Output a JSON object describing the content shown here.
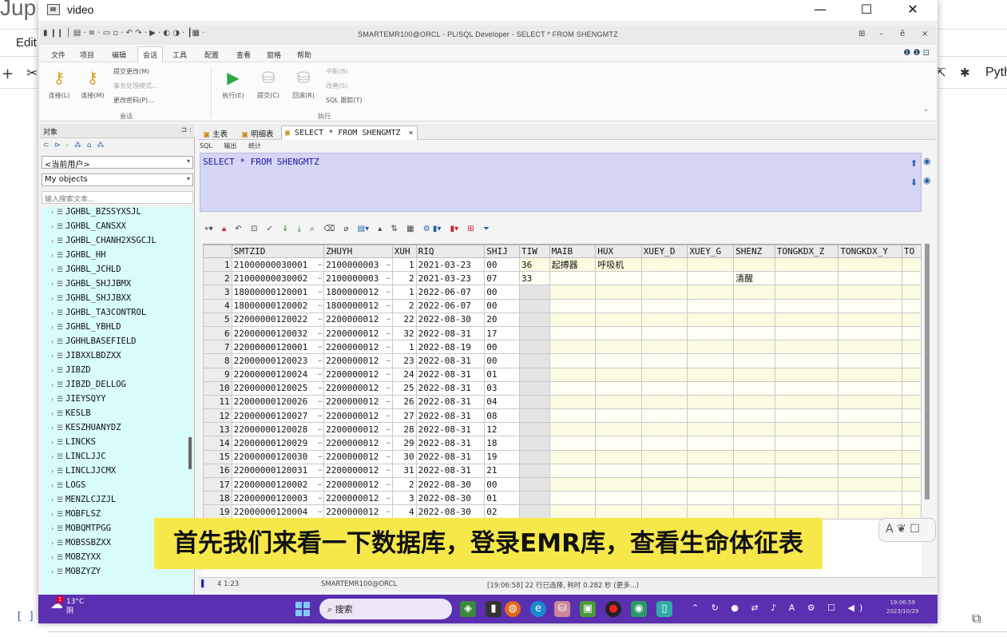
{
  "background": {
    "logo": "Jup",
    "menu_edit": "Edit",
    "plus": "+",
    "right_label": "Pyth",
    "bracket": "[ ]"
  },
  "video_window": {
    "title": "video",
    "minimize": "—",
    "maximize": "☐",
    "close": "✕"
  },
  "app": {
    "title": "SMARTEMR100@ORCL - PL/SQL Developer - SELECT * FROM SHENGMTZ",
    "menus": [
      "文件",
      "项目",
      "编辑",
      "会话",
      "工具",
      "配置",
      "查看",
      "窗格",
      "帮助"
    ],
    "active_menu_index": 3,
    "ribbon": {
      "connect": "连接(L)",
      "logon": "连接(M)",
      "session_items": [
        "提交更改(M)",
        "事务处理模式...",
        "更改密码(P)..."
      ],
      "group_session": "会话",
      "execute": "执行(E)",
      "breakpoint": "提交(C)",
      "rollback": "回滚(R)",
      "exec_items": [
        "中断(B)",
        "改善(S)",
        "SQL 跟踪(T)"
      ],
      "group_exec": "执行"
    },
    "object_panel": {
      "title": "对象",
      "tools": "⊂ ⊳ - ⁂ ⌂ ⁂",
      "combo_user": "<当前用户>",
      "combo_objects": "My objects",
      "filter_placeholder": "输入搜索文本...",
      "items": [
        "JGHBL_BZSSYXSJL",
        "JGHBL_CANSXX",
        "JGHBL_CHANH2XSGCJL",
        "JGHBL_HH",
        "JGHBL_JCHLD",
        "JGHBL_SHJJBMX",
        "JGHBL_SHJJBXX",
        "JGHBL_TA3CONTROL",
        "JGHBL_YBHLD",
        "JGHHLBASEFIELD",
        "JIBXXLBDZXX",
        "JIBZD",
        "JIBZD_DELLOG",
        "JIEYSQYY",
        "KESLB",
        "KESZHUANYDZ",
        "LINCKS",
        "LINCLJJC",
        "LINCLJJCMX",
        "LOGS",
        "MENZLCJZJL",
        "MOBFLSZ",
        "MOBQMTPGG",
        "MOBSSBZXX",
        "MOBZYXX",
        "MOBZYZY"
      ]
    },
    "tabs": [
      {
        "label": "主表"
      },
      {
        "label": "明细表"
      },
      {
        "label": "SELECT * FROM SHENGMTZ"
      }
    ],
    "subtabs": [
      "SQL",
      "输出",
      "统计"
    ],
    "sql_text": "SELECT * FROM SHENGMTZ",
    "grid": {
      "columns": [
        "SMTZID",
        "ZHUYH",
        "XUH",
        "RIQ",
        "SHIJ",
        "TIW",
        "MAIB",
        "HUX",
        "XUEY_D",
        "XUEY_G",
        "SHENZ",
        "TONGKDX_Z",
        "TONGKDX_Y",
        "TO"
      ],
      "rows": [
        [
          "1",
          "21000000030001",
          "2100000003",
          "1",
          "2021-03-23",
          "00",
          "36",
          "起搏器",
          "呼吸机",
          "",
          "",
          "",
          "",
          "",
          ""
        ],
        [
          "2",
          "21000000030002",
          "2100000003",
          "2",
          "2021-03-23",
          "07",
          "33",
          "",
          "",
          "",
          "",
          "清醒",
          "",
          "",
          ""
        ],
        [
          "3",
          "18000000120001",
          "1800000012",
          "1",
          "2022-06-07",
          "00",
          "",
          "",
          "",
          "",
          "",
          "",
          "",
          "",
          ""
        ],
        [
          "4",
          "18000000120002",
          "1800000012",
          "2",
          "2022-06-07",
          "00",
          "",
          "",
          "",
          "",
          "",
          "",
          "",
          "",
          ""
        ],
        [
          "5",
          "22000000120022",
          "2200000012",
          "22",
          "2022-08-30",
          "20",
          "",
          "",
          "",
          "",
          "",
          "",
          "",
          "",
          ""
        ],
        [
          "6",
          "22000000120032",
          "2200000012",
          "32",
          "2022-08-31",
          "17",
          "",
          "",
          "",
          "",
          "",
          "",
          "",
          "",
          ""
        ],
        [
          "7",
          "22000000120001",
          "2200000012",
          "1",
          "2022-08-19",
          "00",
          "",
          "",
          "",
          "",
          "",
          "",
          "",
          "",
          ""
        ],
        [
          "8",
          "22000000120023",
          "2200000012",
          "23",
          "2022-08-31",
          "00",
          "",
          "",
          "",
          "",
          "",
          "",
          "",
          "",
          ""
        ],
        [
          "9",
          "22000000120024",
          "2200000012",
          "24",
          "2022-08-31",
          "01",
          "",
          "",
          "",
          "",
          "",
          "",
          "",
          "",
          ""
        ],
        [
          "10",
          "22000000120025",
          "2200000012",
          "25",
          "2022-08-31",
          "03",
          "",
          "",
          "",
          "",
          "",
          "",
          "",
          "",
          ""
        ],
        [
          "11",
          "22000000120026",
          "2200000012",
          "26",
          "2022-08-31",
          "04",
          "",
          "",
          "",
          "",
          "",
          "",
          "",
          "",
          ""
        ],
        [
          "12",
          "22000000120027",
          "2200000012",
          "27",
          "2022-08-31",
          "08",
          "",
          "",
          "",
          "",
          "",
          "",
          "",
          "",
          ""
        ],
        [
          "13",
          "22000000120028",
          "2200000012",
          "28",
          "2022-08-31",
          "12",
          "",
          "",
          "",
          "",
          "",
          "",
          "",
          "",
          ""
        ],
        [
          "14",
          "22000000120029",
          "2200000012",
          "29",
          "2022-08-31",
          "18",
          "",
          "",
          "",
          "",
          "",
          "",
          "",
          "",
          ""
        ],
        [
          "15",
          "22000000120030",
          "2200000012",
          "30",
          "2022-08-31",
          "19",
          "",
          "",
          "",
          "",
          "",
          "",
          "",
          "",
          ""
        ],
        [
          "16",
          "22000000120031",
          "2200000012",
          "31",
          "2022-08-31",
          "21",
          "",
          "",
          "",
          "",
          "",
          "",
          "",
          "",
          ""
        ],
        [
          "17",
          "22000000120002",
          "2200000012",
          "2",
          "2022-08-30",
          "00",
          "",
          "",
          "",
          "",
          "",
          "",
          "",
          "",
          ""
        ],
        [
          "18",
          "22000000120003",
          "2200000012",
          "3",
          "2022-08-30",
          "01",
          "",
          "",
          "",
          "",
          "",
          "",
          "",
          "",
          ""
        ],
        [
          "19",
          "22000000120004",
          "2200000012",
          "4",
          "2022-08-30",
          "02",
          "",
          "",
          "",
          "",
          "",
          "",
          "",
          "",
          ""
        ]
      ]
    },
    "status": {
      "position": "4  1:23",
      "connection": "SMARTEMR100@ORCL",
      "message": "[19:06:58]  22 行已选择, 耗时 0.282 秒 (更多...)"
    }
  },
  "taskbar": {
    "badge": "1",
    "weather": "13°C",
    "weather_sub": "阴",
    "search": "搜索",
    "clock_time": "19:06:59",
    "clock_date": "2023/10/29"
  },
  "subtitle": "首先我们来看一下数据库，登录EMR库，查看生命体征表",
  "float_widget": "A ❦ ☐",
  "colors": {
    "sql_background": "#d5d5f5",
    "tree_background": "#d8fbfb",
    "subtitle_background": "#f7e84a",
    "taskbar": "#5a2fb0"
  }
}
